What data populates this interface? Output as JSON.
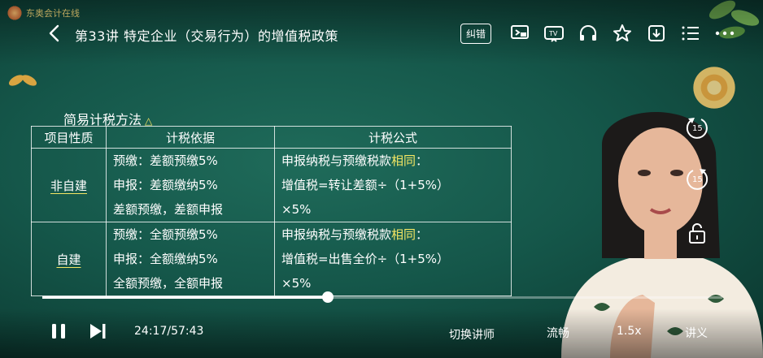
{
  "logo": {
    "text": "东奥会计在线"
  },
  "header": {
    "title": "第33讲 特定企业（交易行为）的增值税政策",
    "feedback_label": "纠错"
  },
  "lesson": {
    "heading": "简易计税方法",
    "heading_mark": "△",
    "columns": [
      "项目性质",
      "计税依据",
      "计税公式"
    ],
    "rows": [
      {
        "type": "非自建",
        "basis": [
          "预缴：差额预缴5%",
          "申报：差额缴纳5%",
          "差额预缴，差额申报"
        ],
        "formula_l1_a": "申报纳税与预缴税款",
        "formula_l1_hl": "相同",
        "formula_l1_b": "：",
        "formula_l2": "增值税=转让差额÷（1+5%）",
        "formula_l3": "×5%"
      },
      {
        "type": "自建",
        "basis": [
          "预缴：全额预缴5%",
          "申报：全额缴纳5%",
          "全额预缴，全额申报"
        ],
        "formula_l1_a": "申报纳税与预缴税款",
        "formula_l1_hl": "相同",
        "formula_l1_b": "：",
        "formula_l2": "增值税=出售全价÷（1+5%）",
        "formula_l3": "×5%"
      }
    ]
  },
  "side": {
    "rewind_label": "15",
    "forward_label": "15"
  },
  "player": {
    "time": "24:17/57:43",
    "progress": 0.42,
    "switch_teacher": "切换讲师",
    "quality": "流畅",
    "speed": "1.5x",
    "notes": "讲义"
  },
  "colors": {
    "board": "#15574a",
    "highlight": "#f5e663"
  },
  "icons": [
    "back-icon",
    "screen-cast-icon",
    "tv-icon",
    "headphones-icon",
    "star-icon",
    "download-icon",
    "playlist-icon",
    "more-icon",
    "lock-icon",
    "pause-icon",
    "next-icon"
  ]
}
